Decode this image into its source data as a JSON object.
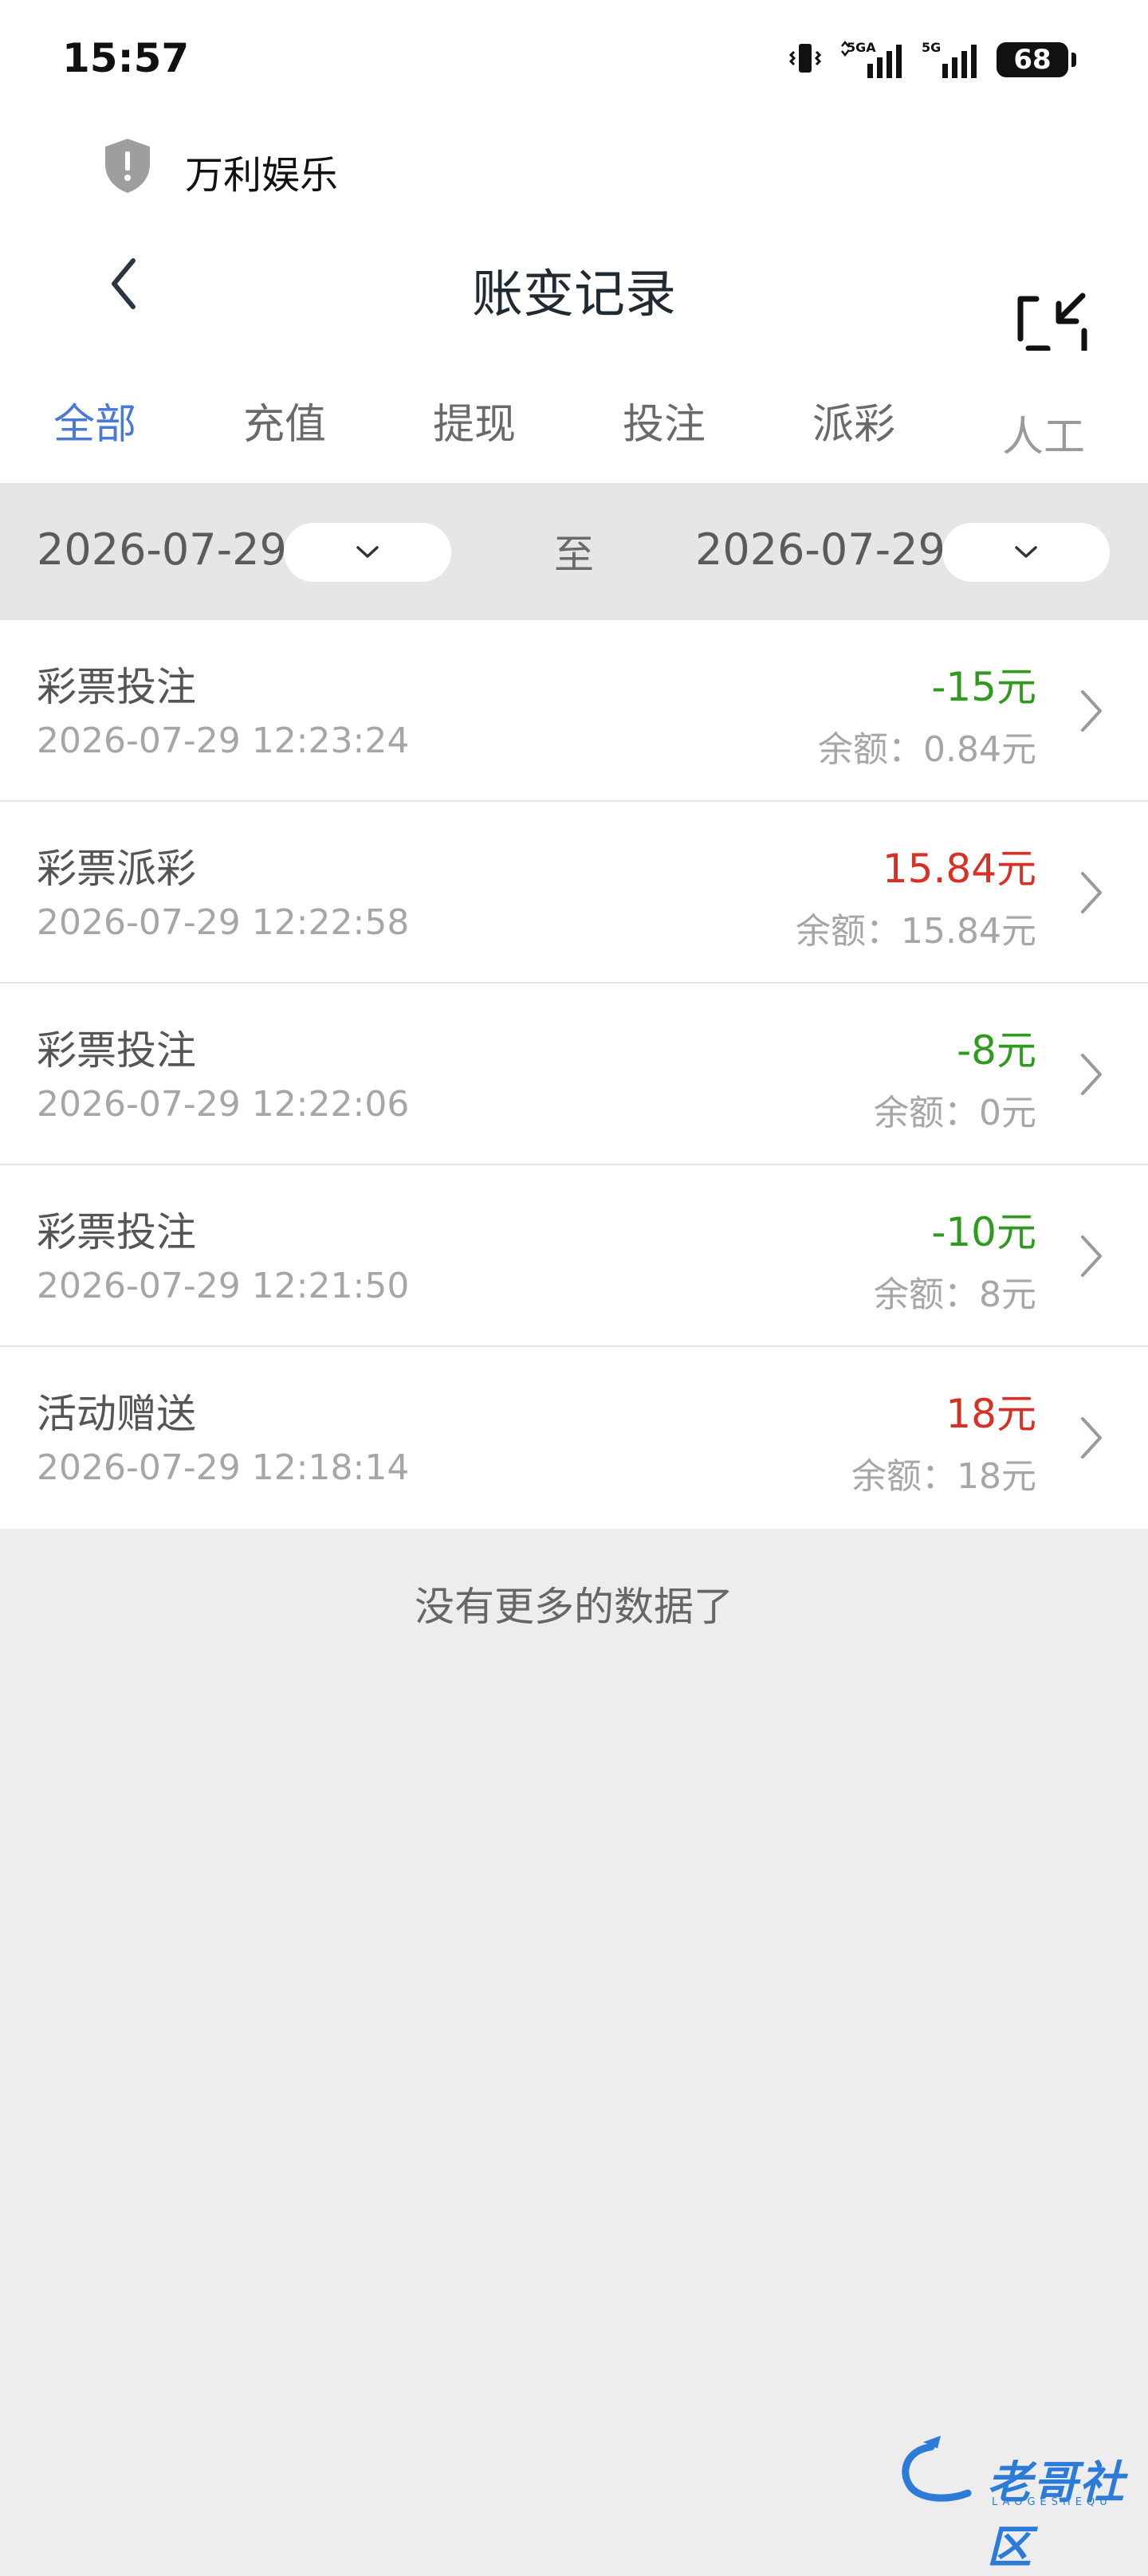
{
  "status_bar": {
    "time": "15:57",
    "network_a": "5GA",
    "network_b": "5G",
    "battery": "68",
    "icons": [
      "vibrate-icon",
      "signal-5ga-icon",
      "signal-5g-icon",
      "battery-icon"
    ]
  },
  "app": {
    "name": "万利娱乐",
    "icon": "shield-alert-icon"
  },
  "nav": {
    "title": "账变记录",
    "back_icon": "chevron-left-icon",
    "collapse_icon": "collapse-arrows-icon"
  },
  "tabs": [
    {
      "label": "全部",
      "active": true
    },
    {
      "label": "充值",
      "active": false
    },
    {
      "label": "提现",
      "active": false
    },
    {
      "label": "投注",
      "active": false
    },
    {
      "label": "派彩",
      "active": false
    },
    {
      "label": "人工",
      "active": false
    }
  ],
  "filter": {
    "start_date": "2026-07-29",
    "to_label": "至",
    "end_date": "2026-07-29"
  },
  "colors": {
    "accent": "#4a7ad8",
    "negative": "#2e9a1e",
    "positive": "#d93025"
  },
  "records": [
    {
      "type": "彩票投注",
      "time": "2026-07-29 12:23:24",
      "amount": "-15元",
      "balance": "余额：0.84元",
      "sign": "negative"
    },
    {
      "type": "彩票派彩",
      "time": "2026-07-29 12:22:58",
      "amount": "15.84元",
      "balance": "余额：15.84元",
      "sign": "positive"
    },
    {
      "type": "彩票投注",
      "time": "2026-07-29 12:22:06",
      "amount": "-8元",
      "balance": "余额：0元",
      "sign": "negative"
    },
    {
      "type": "彩票投注",
      "time": "2026-07-29 12:21:50",
      "amount": "-10元",
      "balance": "余额：8元",
      "sign": "negative"
    },
    {
      "type": "活动赠送",
      "time": "2026-07-29 12:18:14",
      "amount": "18元",
      "balance": "余额：18元",
      "sign": "positive"
    }
  ],
  "footer": {
    "no_more": "没有更多的数据了"
  },
  "watermark": {
    "text": "老哥社区",
    "sub": "LAOGESHEQU"
  }
}
